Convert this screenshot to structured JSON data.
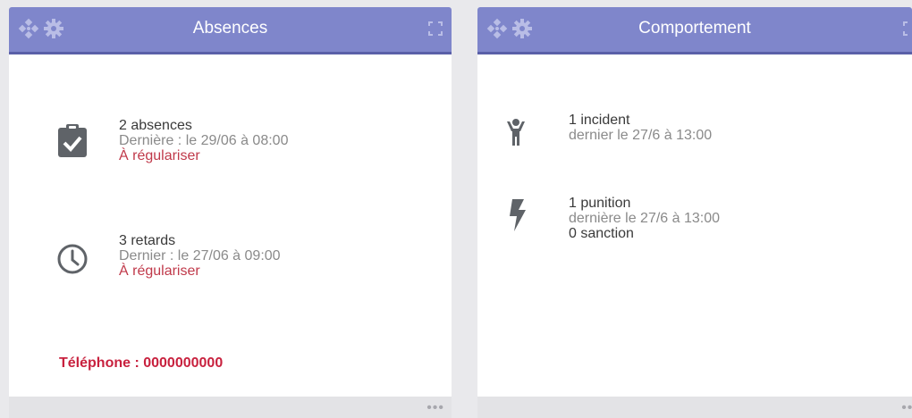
{
  "absences_widget": {
    "title": "Absences",
    "absences": {
      "count_label": "2 absences",
      "last": "Dernière : le 29/06 à 08:00",
      "status": "À régulariser"
    },
    "retards": {
      "count_label": "3 retards",
      "last": "Dernier : le 27/06 à 09:00",
      "status": "À régulariser"
    },
    "phone": "Téléphone : 0000000000",
    "footer_more": "•••"
  },
  "comportement_widget": {
    "title": "Comportement",
    "incident": {
      "count_label": "1 incident",
      "last": "dernier le 27/6 à 13:00"
    },
    "punition": {
      "count_label": "1 punition",
      "last": "dernière le 27/6 à 13:00",
      "sanction": "0 sanction"
    },
    "footer_more": "•••"
  },
  "colors": {
    "header": "#7f86cb",
    "header_border": "#5a60a8",
    "alert_red": "#c0394a",
    "icon_gray": "#5f6368"
  },
  "icons": [
    "move-icon",
    "gear-icon",
    "expand-icon",
    "clipboard-check-icon",
    "clock-icon",
    "incident-figure-icon",
    "lightning-icon"
  ]
}
